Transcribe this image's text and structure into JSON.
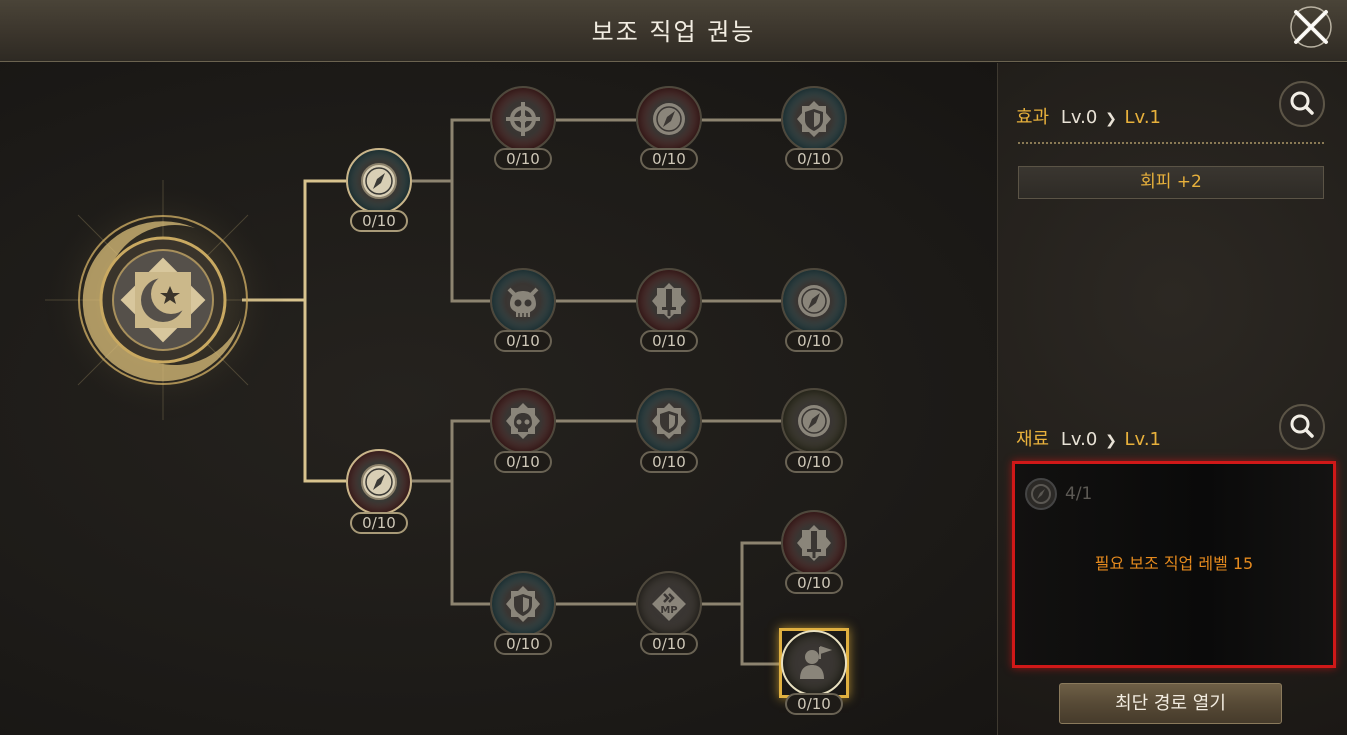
{
  "window": {
    "title": "보조 직업 권능"
  },
  "tree": {
    "tier1": [
      {
        "level": "0/10",
        "icon": "compass-icon",
        "ring": "#2f6f7a"
      },
      {
        "level": "0/10",
        "icon": "compass-icon",
        "ring": "#8a2a2a"
      }
    ],
    "row1": [
      {
        "level": "0/10",
        "icon": "crosshair-icon",
        "ring": "#7a2424"
      },
      {
        "level": "0/10",
        "icon": "compass-icon",
        "ring": "#7a2424"
      },
      {
        "level": "0/10",
        "icon": "shield-icon",
        "ring": "#2f6f7a"
      }
    ],
    "row2": [
      {
        "level": "0/10",
        "icon": "demon-skull-icon",
        "ring": "#2f6f7a"
      },
      {
        "level": "0/10",
        "icon": "sword-icon",
        "ring": "#7a2424"
      },
      {
        "level": "0/10",
        "icon": "compass-icon",
        "ring": "#2f6f7a"
      }
    ],
    "row3": [
      {
        "level": "0/10",
        "icon": "demon-skull-icon",
        "ring": "#7a2424"
      },
      {
        "level": "0/10",
        "icon": "shield-icon",
        "ring": "#2f6f7a"
      },
      {
        "level": "0/10",
        "icon": "compass-icon",
        "ring": "#4a4a2a"
      }
    ],
    "row4": [
      {
        "level": "0/10",
        "icon": "shield-icon",
        "ring": "#2f6f7a"
      },
      {
        "level": "0/10",
        "icon": "mp-boost-icon",
        "ring": "#4a4438"
      },
      {
        "level": "0/10",
        "icon": "sword-icon",
        "ring": "#7a2424"
      },
      {
        "level": "0/10",
        "icon": "figure-flag-icon",
        "ring": "#3a3a2a"
      }
    ]
  },
  "effect": {
    "label": "효과",
    "from": "Lv.0",
    "to": "Lv.1",
    "stat": "회피 +2"
  },
  "material": {
    "label": "재료",
    "from": "Lv.0",
    "to": "Lv.1",
    "count": "4/1",
    "requirement": "필요 보조 직업 레벨 15"
  },
  "actions": {
    "open_path": "최단 경로 열기"
  },
  "colors": {
    "gold": "#e8b13c",
    "warning": "#e58a1e",
    "highlight_border": "#d01818"
  }
}
